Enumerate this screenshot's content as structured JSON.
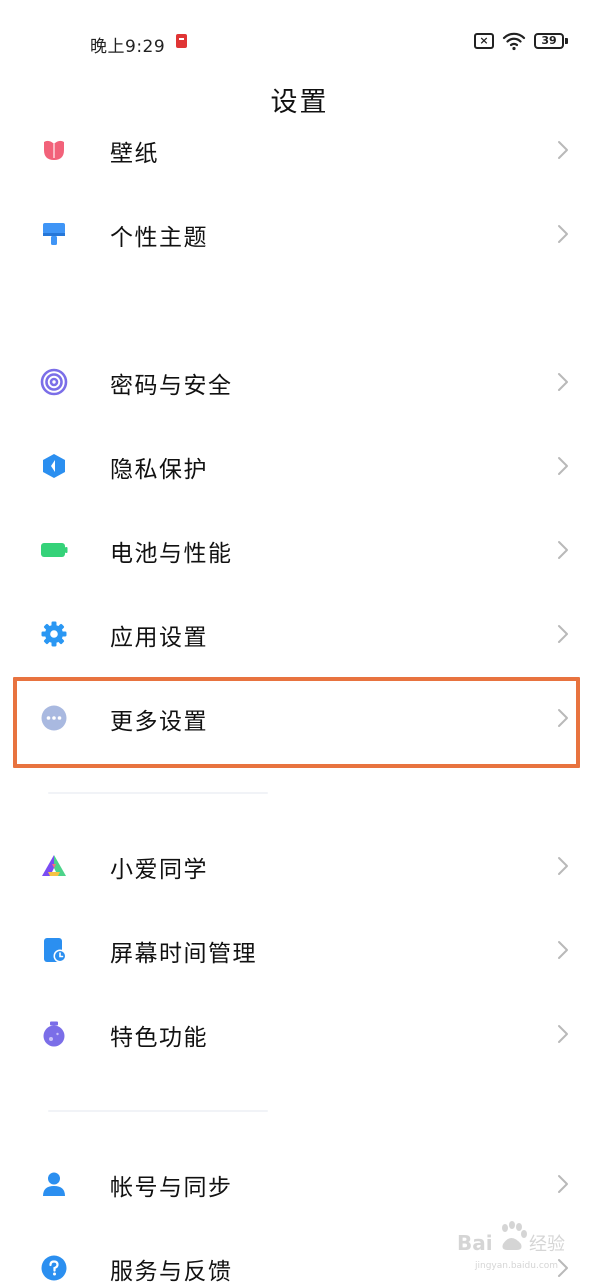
{
  "status_bar": {
    "time": "晚上9:29",
    "battery": "39",
    "sim_status": "×"
  },
  "header": {
    "title": "设置"
  },
  "settings": [
    {
      "label": "壁纸",
      "icon": "wallpaper-icon",
      "color": "#f2627a"
    },
    {
      "label": "个性主题",
      "icon": "theme-brush-icon",
      "color": "#3f95f6"
    },
    {
      "label": "密码与安全",
      "icon": "fingerprint-icon",
      "color": "#7b6ee8"
    },
    {
      "label": "隐私保护",
      "icon": "privacy-shield-icon",
      "color": "#2b8ff0"
    },
    {
      "label": "电池与性能",
      "icon": "battery-icon",
      "color": "#35d279"
    },
    {
      "label": "应用设置",
      "icon": "gear-icon",
      "color": "#2a97f3"
    },
    {
      "label": "更多设置",
      "icon": "more-dots-icon",
      "color": "#9fb1db"
    },
    {
      "label": "小爱同学",
      "icon": "xiaoai-icon",
      "color": "#7a4cf3"
    },
    {
      "label": "屏幕时间管理",
      "icon": "screen-time-icon",
      "color": "#2b8ff0"
    },
    {
      "label": "特色功能",
      "icon": "feature-flask-icon",
      "color": "#7b6ee8"
    },
    {
      "label": "帐号与同步",
      "icon": "account-user-icon",
      "color": "#2b8ff0"
    },
    {
      "label": "服务与反馈",
      "icon": "help-question-icon",
      "color": "#2b8ff0"
    }
  ],
  "highlight_color": "#e8733f",
  "watermark": {
    "text": "Bai 经验",
    "sub": "jingyan.baidu.com"
  }
}
